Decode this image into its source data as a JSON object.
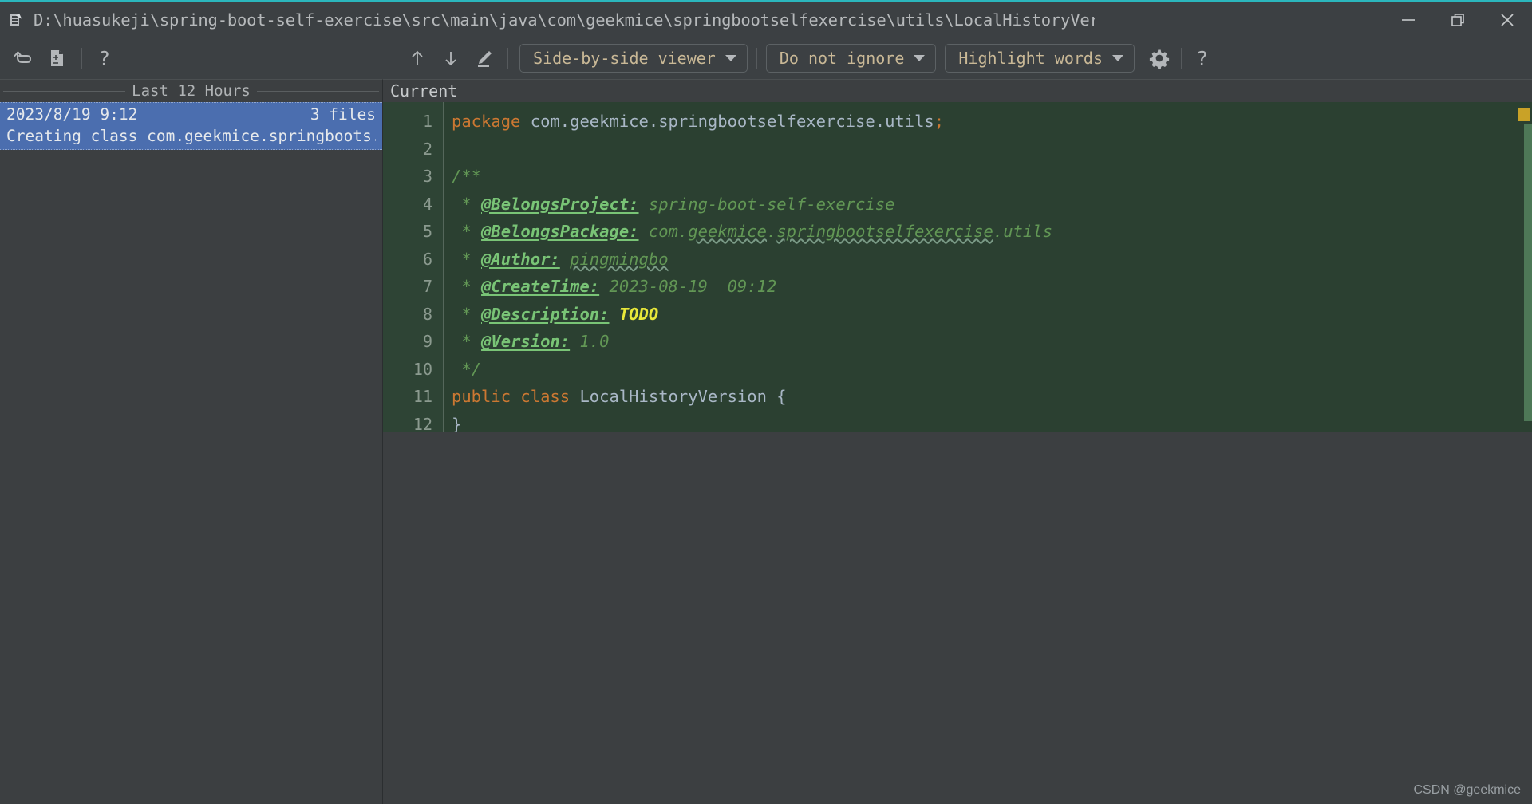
{
  "window": {
    "title": "D:\\huasukeji\\spring-boot-self-exercise\\src\\main\\java\\com\\geekmice\\springbootselfexercise\\utils\\LocalHistoryVersion.jav",
    "icon": "file-with-cursor-icon",
    "controls": {
      "minimize": "minimize-icon",
      "maximize": "restore-icon",
      "close": "close-icon"
    },
    "accent_color": "#2bb7bd"
  },
  "toolbar": {
    "revert_icon": "revert-icon",
    "patch_icon": "create-patch-icon",
    "help_left_label": "?",
    "prev_diff_icon": "arrow-up-icon",
    "next_diff_icon": "arrow-down-icon",
    "edit_icon": "pencil-icon",
    "viewer_mode": "Side-by-side viewer",
    "whitespace_mode": "Do not ignore",
    "highlight_mode": "Highlight words",
    "settings_icon": "gear-icon",
    "help_label": "?"
  },
  "sidebar": {
    "group_label": "Last 12 Hours",
    "items": [
      {
        "timestamp": "2023/8/19 9:12",
        "files": "3 files",
        "description": "Creating class com.geekmice.springboots..",
        "selected": true
      }
    ]
  },
  "diff": {
    "pane_label": "Current",
    "line_numbers": [
      "1",
      "2",
      "3",
      "4",
      "5",
      "6",
      "7",
      "8",
      "9",
      "10",
      "11",
      "12"
    ],
    "lines": [
      {
        "no": "1",
        "segments": [
          {
            "t": "package ",
            "c": "kw"
          },
          {
            "t": "com.geekmice.springbootselfexercise.utils",
            "c": "plain"
          },
          {
            "t": ";",
            "c": "kw"
          }
        ]
      },
      {
        "no": "2",
        "segments": []
      },
      {
        "no": "3",
        "segments": [
          {
            "t": "/**",
            "c": "cmt"
          }
        ]
      },
      {
        "no": "4",
        "segments": [
          {
            "t": " * ",
            "c": "cmt"
          },
          {
            "t": "@BelongsProject:",
            "c": "tag"
          },
          {
            "t": " spring-boot-self-exercise",
            "c": "cmt"
          }
        ]
      },
      {
        "no": "5",
        "segments": [
          {
            "t": " * ",
            "c": "cmt"
          },
          {
            "t": "@BelongsPackage:",
            "c": "tag"
          },
          {
            "t": " com.",
            "c": "cmt"
          },
          {
            "t": "geekmice",
            "c": "cmt wavy"
          },
          {
            "t": ".",
            "c": "cmt"
          },
          {
            "t": "springbootselfexercise",
            "c": "cmt wavy"
          },
          {
            "t": ".utils",
            "c": "cmt"
          }
        ]
      },
      {
        "no": "6",
        "segments": [
          {
            "t": " * ",
            "c": "cmt"
          },
          {
            "t": "@Author:",
            "c": "tag"
          },
          {
            "t": " ",
            "c": "cmt"
          },
          {
            "t": "pingmingbo",
            "c": "cmt wavy"
          }
        ]
      },
      {
        "no": "7",
        "segments": [
          {
            "t": " * ",
            "c": "cmt"
          },
          {
            "t": "@CreateTime:",
            "c": "tag"
          },
          {
            "t": " 2023-08-19  09:12",
            "c": "cmt"
          }
        ]
      },
      {
        "no": "8",
        "segments": [
          {
            "t": " * ",
            "c": "cmt"
          },
          {
            "t": "@Description:",
            "c": "tag"
          },
          {
            "t": " ",
            "c": "cmt"
          },
          {
            "t": "TODO",
            "c": "todo"
          }
        ]
      },
      {
        "no": "9",
        "segments": [
          {
            "t": " * ",
            "c": "cmt"
          },
          {
            "t": "@Version:",
            "c": "tag"
          },
          {
            "t": " 1.0",
            "c": "cmt"
          }
        ]
      },
      {
        "no": "10",
        "segments": [
          {
            "t": " */",
            "c": "cmt"
          }
        ]
      },
      {
        "no": "11",
        "segments": [
          {
            "t": "public class ",
            "c": "kw"
          },
          {
            "t": "LocalHistoryVersion",
            "c": "cls"
          },
          {
            "t": " {",
            "c": "plain"
          }
        ]
      },
      {
        "no": "12",
        "segments": [
          {
            "t": "}",
            "c": "plain"
          }
        ]
      }
    ],
    "added_background": "#2b4031",
    "todo_marker_color": "#c9a227"
  },
  "watermark": "CSDN @geekmice"
}
